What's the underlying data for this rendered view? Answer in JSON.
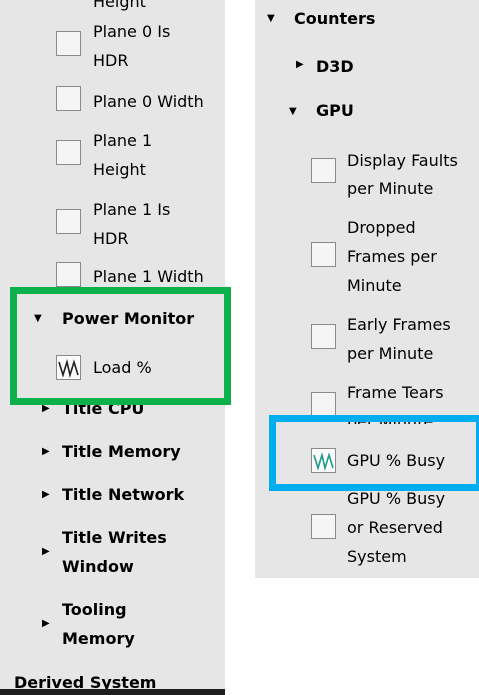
{
  "left_panel": {
    "items": [
      {
        "lines": [
          "Height"
        ]
      },
      {
        "lines": [
          "Plane 0 Is",
          "HDR"
        ]
      },
      {
        "lines": [
          "Plane 0 Width"
        ]
      },
      {
        "lines": [
          "Plane 1",
          "Height"
        ]
      },
      {
        "lines": [
          "Plane 1 Is",
          "HDR"
        ]
      },
      {
        "lines": [
          "Plane 1 Width"
        ]
      }
    ],
    "power_monitor": {
      "label": "Power Monitor",
      "counter": "Load %"
    },
    "groups": [
      {
        "lines": [
          "Title CPU"
        ]
      },
      {
        "lines": [
          "Title Memory"
        ]
      },
      {
        "lines": [
          "Title Network"
        ]
      },
      {
        "lines": [
          "Title Writes",
          "Window"
        ]
      },
      {
        "lines": [
          "Tooling",
          "Memory"
        ]
      },
      {
        "lines": [
          "Derived System"
        ]
      }
    ]
  },
  "right_panel": {
    "header": "Counters",
    "d3d": "D3D",
    "gpu": "GPU",
    "items": [
      {
        "lines": [
          "Display Faults",
          "per Minute"
        ]
      },
      {
        "lines": [
          "Dropped",
          "Frames per",
          "Minute"
        ]
      },
      {
        "lines": [
          "Early Frames",
          "per Minute"
        ]
      },
      {
        "lines": [
          "Frame Tears",
          "per Minute"
        ]
      },
      {
        "lines": [
          "GPU % Busy"
        ]
      },
      {
        "lines": [
          "GPU % Busy",
          "or Reserved",
          "System"
        ]
      }
    ]
  },
  "colors": {
    "green_highlight": "#0db14b",
    "blue_highlight": "#00aeef",
    "chart_icon": "#1a9c8c"
  }
}
